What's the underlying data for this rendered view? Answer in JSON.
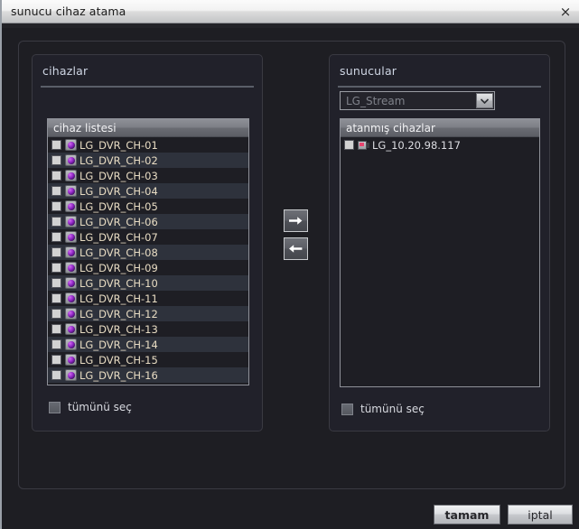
{
  "window": {
    "title": "sunucu cihaz atama",
    "close_icon": "close-icon",
    "close_glyph": "×"
  },
  "left_panel": {
    "title": "cihazlar",
    "list_header": "cihaz listesi",
    "items": [
      "LG_DVR_CH-01",
      "LG_DVR_CH-02",
      "LG_DVR_CH-03",
      "LG_DVR_CH-04",
      "LG_DVR_CH-05",
      "LG_DVR_CH-06",
      "LG_DVR_CH-07",
      "LG_DVR_CH-08",
      "LG_DVR_CH-09",
      "LG_DVR_CH-10",
      "LG_DVR_CH-11",
      "LG_DVR_CH-12",
      "LG_DVR_CH-13",
      "LG_DVR_CH-14",
      "LG_DVR_CH-15",
      "LG_DVR_CH-16"
    ],
    "item_icon": "camera-icon",
    "select_all_label": "tümünü seç",
    "select_all_checked": false
  },
  "right_panel": {
    "title": "sunucular",
    "server_select": {
      "value": "LG_Stream",
      "arrow_icon": "chevron-down-icon"
    },
    "list_header": "atanmış cihazlar",
    "items": [
      "LG_10.20.98.117"
    ],
    "item_icon": "dvr-icon",
    "select_all_label": "tümünü seç",
    "select_all_checked": false
  },
  "transfer": {
    "assign_icon": "arrow-right-icon",
    "unassign_icon": "arrow-left-icon"
  },
  "footer": {
    "ok_label": "tamam",
    "cancel_label": "iptal"
  },
  "colors": {
    "window_bg": "#1e1e23",
    "titlebar_top": "#fbfbfb",
    "titlebar_bottom": "#c3c4c6",
    "row_odd": "#1e1e24",
    "row_even": "#2e323c",
    "left_item_text": "#e8dcc3",
    "right_item_text": "#dcdde2",
    "panel_title_text": "#cfd6e4",
    "list_header_grad_top": "#8e9097",
    "list_header_grad_bottom": "#5c5e65",
    "camera_icon_dome": "#9326c8",
    "dvr_icon_screen": "#e8456f",
    "button_face": "#dcdee1"
  }
}
